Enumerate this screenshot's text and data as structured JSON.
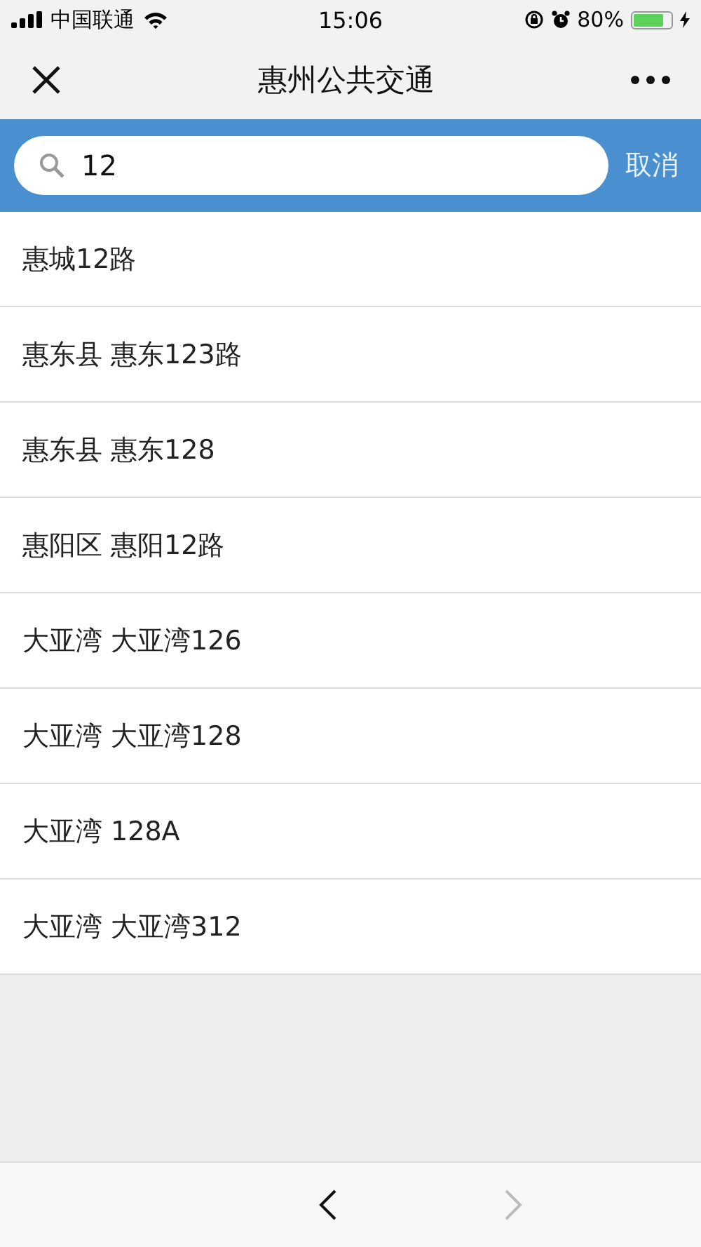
{
  "status_bar": {
    "carrier": "中国联通",
    "time": "15:06",
    "battery": "80%"
  },
  "window": {
    "title": "惠州公共交通"
  },
  "search": {
    "value": "12",
    "cancel": "取消"
  },
  "results": [
    {
      "label": "惠城12路"
    },
    {
      "label": "惠东县 惠东123路"
    },
    {
      "label": "惠东县 惠东128"
    },
    {
      "label": "惠阳区 惠阳12路"
    },
    {
      "label": "大亚湾 大亚湾126"
    },
    {
      "label": "大亚湾 大亚湾128"
    },
    {
      "label": "大亚湾 128A"
    },
    {
      "label": "大亚湾 大亚湾312"
    }
  ],
  "toolbar": {
    "back_disabled": false,
    "forward_disabled": true
  }
}
